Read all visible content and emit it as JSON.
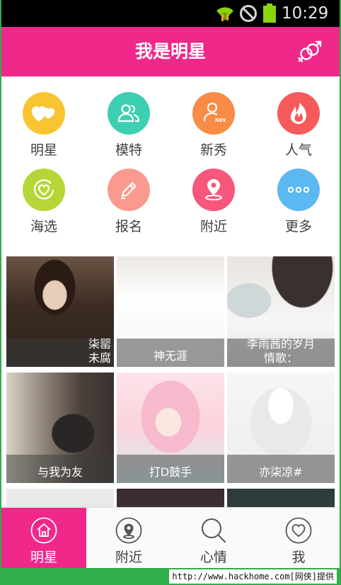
{
  "status_bar": {
    "time": "10:29"
  },
  "app_bar": {
    "title": "我是明星"
  },
  "categories": [
    {
      "label": "明星",
      "icon": "hearts-icon",
      "color": "#f9c431"
    },
    {
      "label": "模特",
      "icon": "people-icon",
      "color": "#3dcfb1"
    },
    {
      "label": "新秀",
      "icon": "new-person-icon",
      "color": "#f88b46"
    },
    {
      "label": "人气",
      "icon": "flame-icon",
      "color": "#f75a5a"
    },
    {
      "label": "海选",
      "icon": "heart-circle-icon",
      "color": "#b6d637"
    },
    {
      "label": "报名",
      "icon": "pencil-icon",
      "color": "#fa9a8e"
    },
    {
      "label": "附近",
      "icon": "location-pin-icon",
      "color": "#f7577b"
    },
    {
      "label": "更多",
      "icon": "more-dots-icon",
      "color": "#5cb8f0"
    }
  ],
  "photos": [
    {
      "caption": "柒罂\n未腐"
    },
    {
      "caption": "神无涯"
    },
    {
      "caption": "李雨茜的岁月\n情歌："
    },
    {
      "caption": "与我为友"
    },
    {
      "caption": "打D鼓手"
    },
    {
      "caption": "亦柒凉#"
    },
    {
      "caption": ""
    },
    {
      "caption": ""
    },
    {
      "caption": ""
    }
  ],
  "bottom_nav": [
    {
      "label": "明星",
      "icon": "home-icon",
      "active": true
    },
    {
      "label": "附近",
      "icon": "location-pin-icon",
      "active": false
    },
    {
      "label": "心情",
      "icon": "search-icon",
      "active": false
    },
    {
      "label": "我",
      "icon": "heart-circle-icon",
      "active": false
    }
  ],
  "watermark": {
    "text": "http://www.hackhome.com[网侠]提供"
  },
  "colors": {
    "accent": "#f0288a",
    "statusbar": "#000000",
    "frame": "#2fae4a"
  }
}
